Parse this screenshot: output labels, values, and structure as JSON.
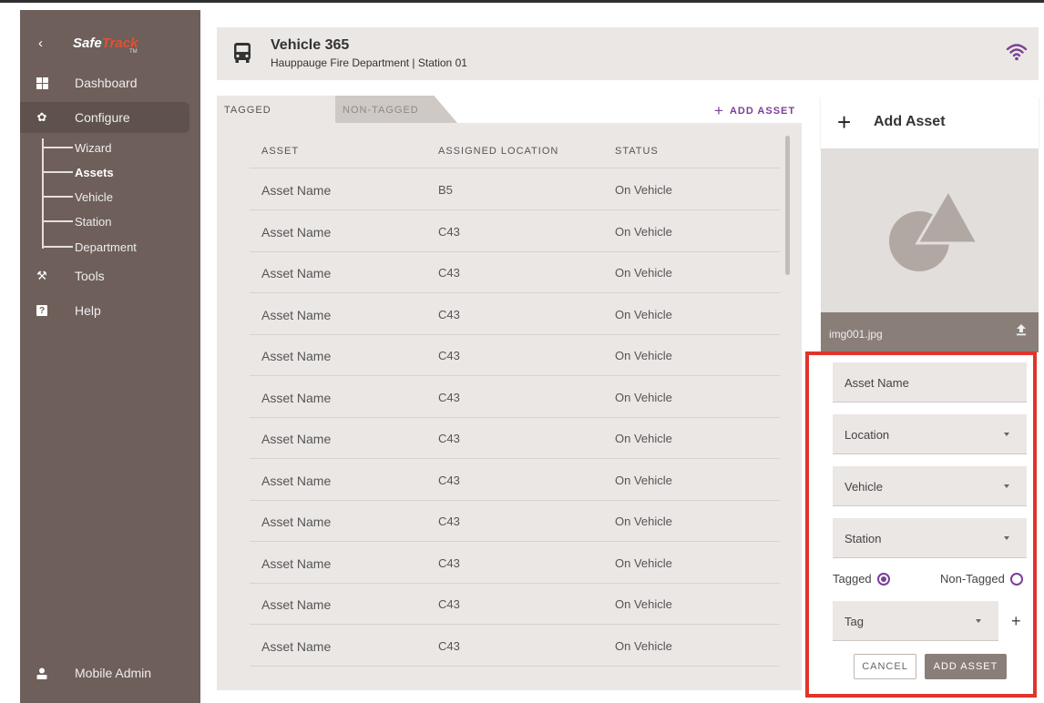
{
  "sidebar": {
    "logo_part1": "Safe",
    "logo_part2": "Track",
    "logo_tm": "TM",
    "nav": [
      {
        "label": "Dashboard",
        "icon": "dashboard-icon"
      },
      {
        "label": "Configure",
        "icon": "gear-icon"
      },
      {
        "label": "Tools",
        "icon": "tools-icon"
      },
      {
        "label": "Help",
        "icon": "help-icon"
      }
    ],
    "sub": [
      "Wizard",
      "Assets",
      "Vehicle",
      "Station",
      "Department"
    ],
    "active_sub": "Assets",
    "user": "Mobile Admin"
  },
  "header": {
    "title": "Vehicle 365",
    "subtitle": "Hauppauge Fire Department | Station 01"
  },
  "tabs": {
    "tagged": "TAGGED",
    "non_tagged": "NON-TAGGED",
    "add_asset": "ADD ASSET"
  },
  "table": {
    "columns": [
      "ASSET",
      "ASSIGNED LOCATION",
      "STATUS"
    ],
    "rows": [
      [
        "Asset Name",
        "B5",
        "On Vehicle"
      ],
      [
        "Asset Name",
        "C43",
        "On Vehicle"
      ],
      [
        "Asset Name",
        "C43",
        "On Vehicle"
      ],
      [
        "Asset Name",
        "C43",
        "On Vehicle"
      ],
      [
        "Asset Name",
        "C43",
        "On Vehicle"
      ],
      [
        "Asset Name",
        "C43",
        "On Vehicle"
      ],
      [
        "Asset Name",
        "C43",
        "On Vehicle"
      ],
      [
        "Asset Name",
        "C43",
        "On Vehicle"
      ],
      [
        "Asset Name",
        "C43",
        "On Vehicle"
      ],
      [
        "Asset Name",
        "C43",
        "On Vehicle"
      ],
      [
        "Asset Name",
        "C43",
        "On Vehicle"
      ],
      [
        "Asset Name",
        "C43",
        "On Vehicle"
      ]
    ]
  },
  "panel": {
    "title": "Add Asset",
    "image_file": "img001.jpg",
    "fields": {
      "asset_name": "Asset Name",
      "location": "Location",
      "vehicle": "Vehicle",
      "station": "Station",
      "tag": "Tag"
    },
    "radio_tagged": "Tagged",
    "radio_non_tagged": "Non-Tagged",
    "cancel": "CANCEL",
    "add": "ADD ASSET"
  },
  "colors": {
    "sidebar": "#6e5f5a",
    "accent": "#7b3f99",
    "logo_red": "#e2502f",
    "highlight": "#e0342c"
  }
}
